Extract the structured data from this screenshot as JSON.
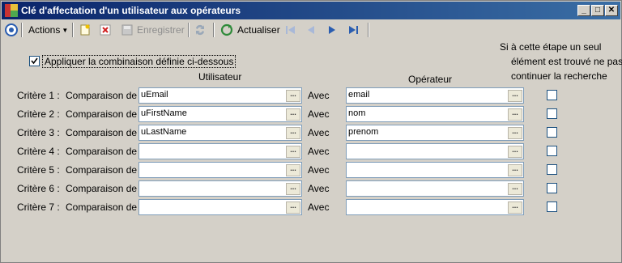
{
  "window": {
    "title": "Clé d'affectation d'un utilisateur aux opérateurs"
  },
  "toolbar": {
    "actions_label": "Actions",
    "save_label": "Enregistrer",
    "refresh_label": "Actualiser"
  },
  "options": {
    "apply_combination_label": "Appliquer la combinaison définie ci-dessous",
    "apply_combination_checked": true,
    "stop_search_label_line1": "Si à cette étape un seul",
    "stop_search_label_line2": "élément est trouvé ne pas",
    "stop_search_label_line3": "continuer la recherche"
  },
  "columns": {
    "user": "Utilisateur",
    "operator": "Opérateur"
  },
  "criteria": [
    {
      "label": "Critère 1 :",
      "compare": "Comparaison de :",
      "user_value": "uEmail",
      "with": "Avec",
      "operator_value": "email"
    },
    {
      "label": "Critère 2 :",
      "compare": "Comparaison de :",
      "user_value": "uFirstName",
      "with": "Avec",
      "operator_value": "nom"
    },
    {
      "label": "Critère 3 :",
      "compare": "Comparaison de :",
      "user_value": "uLastName",
      "with": "Avec",
      "operator_value": "prenom"
    },
    {
      "label": "Critère 4 :",
      "compare": "Comparaison de :",
      "user_value": "",
      "with": "Avec",
      "operator_value": ""
    },
    {
      "label": "Critère 5 :",
      "compare": "Comparaison de :",
      "user_value": "",
      "with": "Avec",
      "operator_value": ""
    },
    {
      "label": "Critère 6 :",
      "compare": "Comparaison de :",
      "user_value": "",
      "with": "Avec",
      "operator_value": ""
    },
    {
      "label": "Critère 7 :",
      "compare": "Comparaison de :",
      "user_value": "",
      "with": "Avec",
      "operator_value": ""
    }
  ],
  "browse_button_label": "..."
}
